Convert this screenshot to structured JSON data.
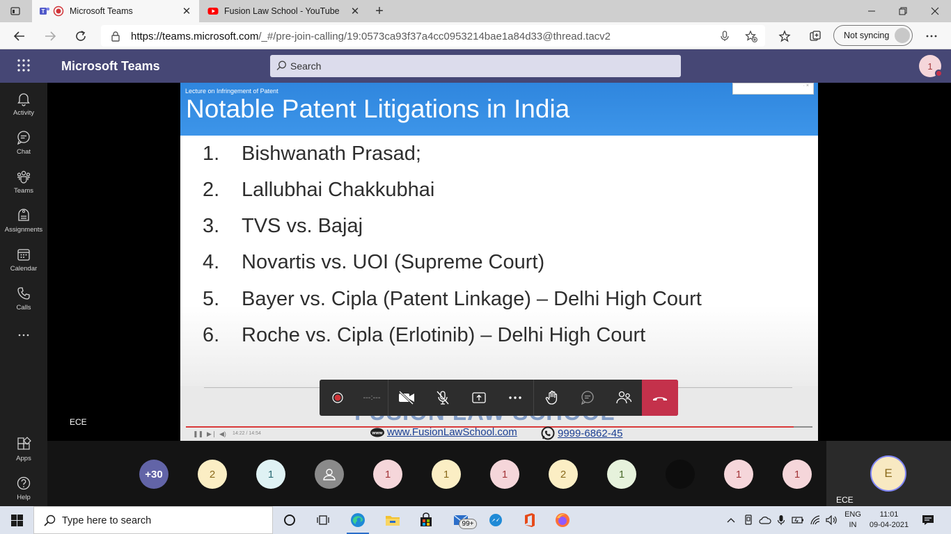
{
  "browser": {
    "tabs": [
      {
        "title": "Microsoft Teams",
        "favicon": "teams-icon",
        "active": true
      },
      {
        "title": "Fusion Law School - YouTube",
        "favicon": "youtube-icon",
        "active": false
      }
    ],
    "url_prefix": "https://teams.microsoft.com",
    "url_path": "/_#/pre-join-calling/19:0573ca93f37a4cc0953214bae1a84d33@thread.tacv2",
    "sync_label": "Not syncing"
  },
  "teams": {
    "app_name": "Microsoft Teams",
    "search_placeholder": "Search",
    "avatar_initial": "1",
    "accent_color": "#464775",
    "rail": [
      {
        "label": "Activity",
        "icon": "bell-icon"
      },
      {
        "label": "Chat",
        "icon": "chat-icon"
      },
      {
        "label": "Teams",
        "icon": "teams-icon"
      },
      {
        "label": "Assignments",
        "icon": "assignments-icon"
      },
      {
        "label": "Calendar",
        "icon": "calendar-icon"
      },
      {
        "label": "Calls",
        "icon": "phone-icon"
      },
      {
        "label": "Apps",
        "icon": "apps-icon"
      },
      {
        "label": "Help",
        "icon": "help-icon"
      }
    ]
  },
  "stage": {
    "presenter_name": "ECE",
    "slide": {
      "subtitle": "Lecture on Infringement of Patent",
      "title": "Notable Patent Litigations in India",
      "items": [
        {
          "num": "1.",
          "text": "Bishwanath Prasad;"
        },
        {
          "num": "2.",
          "text": "Lallubhai Chakkubhai"
        },
        {
          "num": "3.",
          "text": "TVS vs. Bajaj"
        },
        {
          "num": "4.",
          "text": "Novartis vs. UOI (Supreme Court)"
        },
        {
          "num": "5.",
          "text": "Bayer vs. Cipla (Patent Linkage) – Delhi High Court"
        },
        {
          "num": "6.",
          "text": "Roche vs. Cipla (Erlotinib) – Delhi High Court"
        }
      ],
      "logo_text": "FUSION LAW SCHOOL",
      "website": "www.FusionLawSchool.com",
      "phone": "9999-6862-45",
      "video_time": "14:22 / 14:54",
      "video_progress": 0.97
    },
    "call_timer": "---:---"
  },
  "participants": [
    {
      "label": "+30",
      "bg": "#6264a7",
      "fg": "#ffffff"
    },
    {
      "label": "2",
      "bg": "#fbeec4",
      "fg": "#8a6a1c"
    },
    {
      "label": "1",
      "bg": "#dff2f4",
      "fg": "#2a6a73"
    },
    {
      "label": "",
      "bg": "#8a8a8a",
      "fg": "#ffffff",
      "icon": "person-icon"
    },
    {
      "label": "1",
      "bg": "#f5d6da",
      "fg": "#a4373a"
    },
    {
      "label": "1",
      "bg": "#fbeec4",
      "fg": "#8a6a1c"
    },
    {
      "label": "1",
      "bg": "#f5d6da",
      "fg": "#a4373a"
    },
    {
      "label": "2",
      "bg": "#fbeec4",
      "fg": "#8a6a1c"
    },
    {
      "label": "1",
      "bg": "#e6f2dc",
      "fg": "#4b6b2c"
    },
    {
      "label": "",
      "bg": "#0d0d0d",
      "fg": "#ffffff",
      "icon": "photo-avatar"
    },
    {
      "label": "1",
      "bg": "#f5d6da",
      "fg": "#a4373a"
    },
    {
      "label": "1",
      "bg": "#f5d6da",
      "fg": "#a4373a"
    }
  ],
  "self": {
    "initial": "E",
    "name": "ECE"
  },
  "taskbar": {
    "search_placeholder": "Type here to search",
    "mail_badge": "99+",
    "lang_top": "ENG",
    "lang_bottom": "IN",
    "time": "11:01",
    "date": "09-04-2021"
  }
}
